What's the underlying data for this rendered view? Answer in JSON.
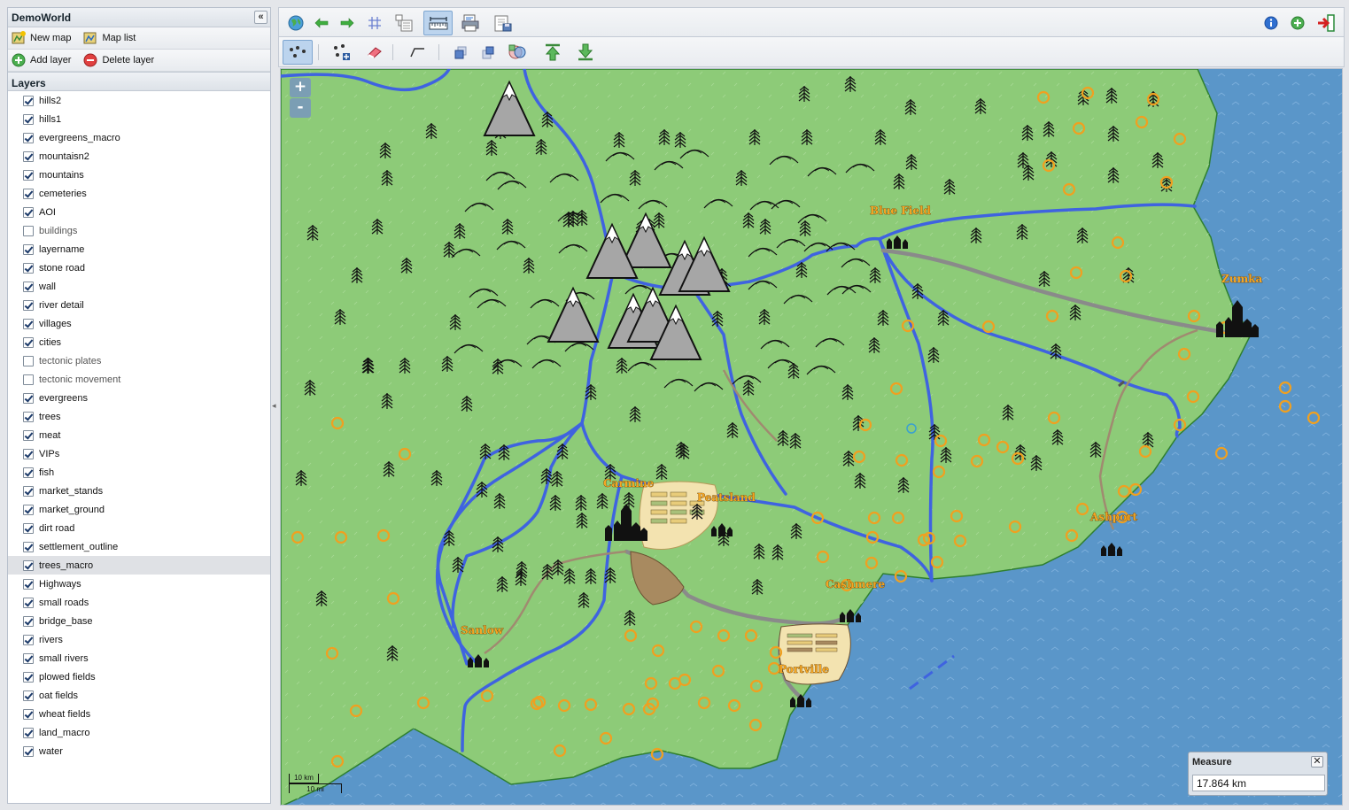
{
  "sidebar": {
    "title": "DemoWorld",
    "collapse_label": "«",
    "new_map": "New map",
    "map_list": "Map list",
    "add_layer": "Add layer",
    "delete_layer": "Delete layer",
    "layers_heading": "Layers",
    "layers": [
      {
        "name": "hills2",
        "checked": true
      },
      {
        "name": "hills1",
        "checked": true
      },
      {
        "name": "evergreens_macro",
        "checked": true
      },
      {
        "name": "mountaisn2",
        "checked": true
      },
      {
        "name": "mountains",
        "checked": true
      },
      {
        "name": "cemeteries",
        "checked": true
      },
      {
        "name": "AOI",
        "checked": true
      },
      {
        "name": "buildings",
        "checked": false
      },
      {
        "name": "layername",
        "checked": true
      },
      {
        "name": "stone road",
        "checked": true
      },
      {
        "name": "wall",
        "checked": true
      },
      {
        "name": "river detail",
        "checked": true
      },
      {
        "name": "villages",
        "checked": true
      },
      {
        "name": "cities",
        "checked": true
      },
      {
        "name": "tectonic plates",
        "checked": false
      },
      {
        "name": "tectonic movement",
        "checked": false
      },
      {
        "name": "evergreens",
        "checked": true
      },
      {
        "name": "trees",
        "checked": true
      },
      {
        "name": "meat",
        "checked": true
      },
      {
        "name": "VIPs",
        "checked": true
      },
      {
        "name": "fish",
        "checked": true
      },
      {
        "name": "market_stands",
        "checked": true
      },
      {
        "name": "market_ground",
        "checked": true
      },
      {
        "name": "dirt road",
        "checked": true
      },
      {
        "name": "settlement_outline",
        "checked": true
      },
      {
        "name": "trees_macro",
        "checked": true,
        "selected": true
      },
      {
        "name": "Highways",
        "checked": true
      },
      {
        "name": "small roads",
        "checked": true
      },
      {
        "name": "bridge_base",
        "checked": true
      },
      {
        "name": "rivers",
        "checked": true
      },
      {
        "name": "small rivers",
        "checked": true
      },
      {
        "name": "plowed fields",
        "checked": true
      },
      {
        "name": "oat fields",
        "checked": true
      },
      {
        "name": "wheat fields",
        "checked": true
      },
      {
        "name": "land_macro",
        "checked": true
      },
      {
        "name": "water",
        "checked": true
      }
    ]
  },
  "map": {
    "zoom_in": "+",
    "zoom_out": "-",
    "places": [
      "Blue Field",
      "Zumka",
      "Carmine",
      "Peatsland",
      "Ashport",
      "Cashmere",
      "Sanlow",
      "Portville"
    ],
    "scale_km": "10 km",
    "scale_mi": "10 mi",
    "colors": {
      "water": "#5a96c9",
      "land": "#8dcb78",
      "river": "#3f63e0",
      "road": "#8a8a8a",
      "dirt_road": "#a08a70",
      "orange_marker": "#f0a020"
    }
  },
  "measure": {
    "title": "Measure",
    "close": "✕",
    "value": "17.864 km"
  },
  "toolbar_icons": [
    "globe-icon",
    "back-arrow-icon",
    "forward-arrow-icon",
    "grid-icon",
    "layer-tree-icon",
    "measure-ruler-icon",
    "map-print-icon",
    "map-save-icon",
    "info-icon",
    "add-icon",
    "logout-icon",
    "select-points-icon",
    "add-point-icon",
    "eraser-icon",
    "draw-line-icon",
    "bring-forward-icon",
    "send-back-icon",
    "intersect-icon",
    "move-top-icon",
    "move-bottom-icon"
  ]
}
